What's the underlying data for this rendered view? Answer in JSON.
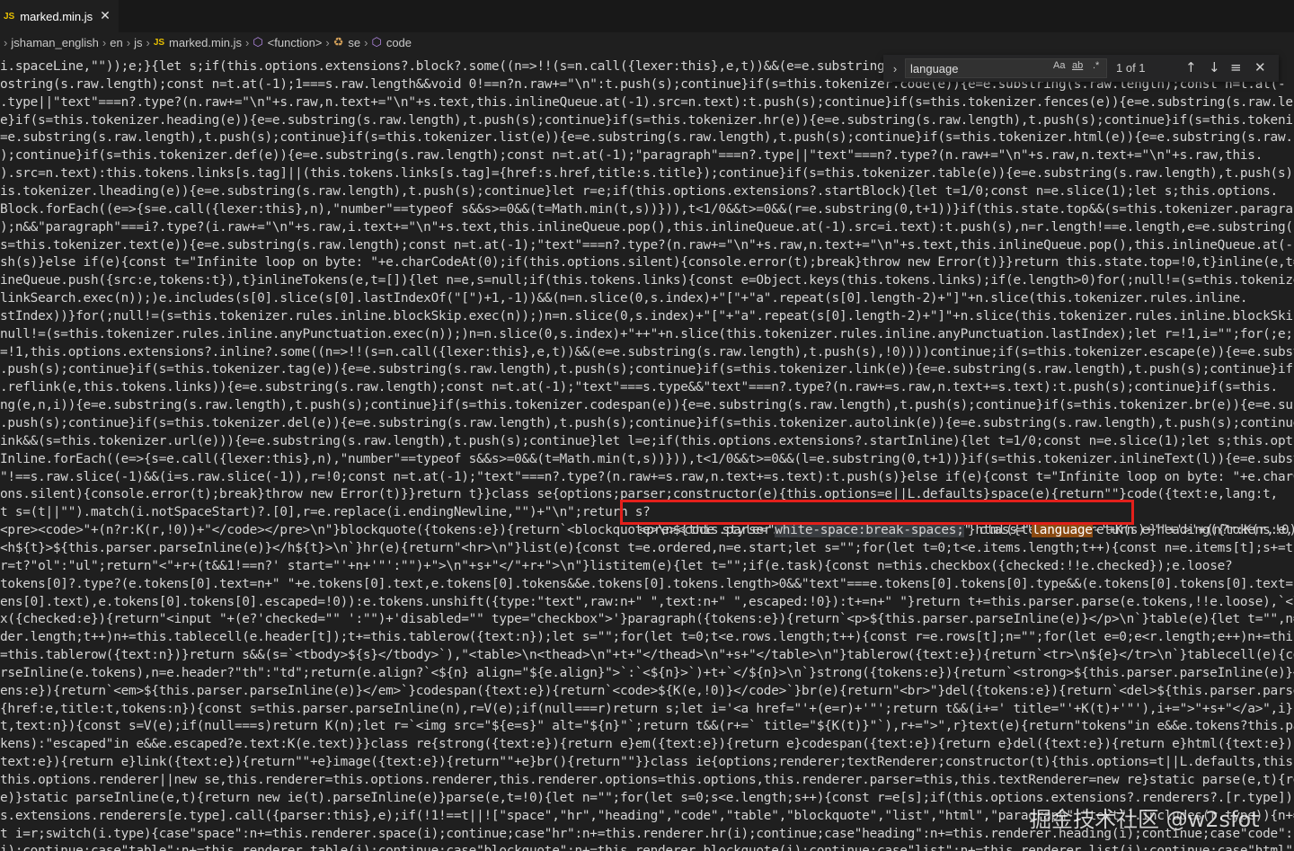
{
  "tab": {
    "icon": "JS",
    "filename": "marked.min.js",
    "close_glyph": "✕"
  },
  "breadcrumb": {
    "items": [
      "jshaman_english",
      "en",
      "js",
      "marked.min.js",
      "<function>",
      "se",
      "code"
    ],
    "file_icon": "JS"
  },
  "find_widget": {
    "query": "language",
    "match_case": "Aa",
    "whole_word": "ab",
    "regex": ".*",
    "result_count": "1 of 1"
  },
  "code_lines": [
    "i.spaceLine,\"\"));e;}{let s;if(this.options.extensions?.block?.some((n=>!!(s=n.call({lexer:this},e,t))&&(e=e.substring(s.raw.",
    "ostring(s.raw.length);const n=t.at(-1);1===s.raw.length&&void 0!==n?n.raw+=\"\\n\":t.push(s);continue}if(s=this.tokenizer.code(e)){e=e.substring(s.raw.length);const n=t.at(-",
    ".type||\"text\"===n?.type?(n.raw+=\"\\n\"+s.raw,n.text+=\"\\n\"+s.text,this.inlineQueue.at(-1).src=n.text):t.push(s);continue}if(s=this.tokenizer.fences(e)){e=e.substring(s.raw.length),",
    "e}if(s=this.tokenizer.heading(e)){e=e.substring(s.raw.length),t.push(s);continue}if(s=this.tokenizer.hr(e)){e=e.substring(s.raw.length),t.push(s);continue}if(s=this.tokenizer.",
    "=e.substring(s.raw.length),t.push(s);continue}if(s=this.tokenizer.list(e)){e=e.substring(s.raw.length),t.push(s);continue}if(s=this.tokenizer.html(e)){e=e.substring(s.raw.",
    ");continue}if(s=this.tokenizer.def(e)){e=e.substring(s.raw.length);const n=t.at(-1);\"paragraph\"===n?.type||\"text\"===n?.type?(n.raw+=\"\\n\"+s.raw,n.text+=\"\\n\"+s.raw,this.",
    ").src=n.text):this.tokens.links[s.tag]||(this.tokens.links[s.tag]={href:s.href,title:s.title});continue}if(s=this.tokenizer.table(e)){e=e.substring(s.raw.length),t.push(s);",
    "is.tokenizer.lheading(e)){e=e.substring(s.raw.length),t.push(s);continue}let r=e;if(this.options.extensions?.startBlock){let t=1/0;const n=e.slice(1);let s;this.options.",
    "Block.forEach((e=>{s=e.call({lexer:this},n),\"number\"==typeof s&&s>=0&&(t=Math.min(t,s))})),t<1/0&&t>=0&&(r=e.substring(0,t+1))}if(this.state.top&&(s=this.tokenizer.paragraph(r)))",
    ");n&&\"paragraph\"===i?.type?(i.raw+=\"\\n\"+s.raw,i.text+=\"\\n\"+s.text,this.inlineQueue.pop(),this.inlineQueue.at(-1).src=i.text):t.push(s),n=r.length!==e.length,e=e.substring(s.raw.",
    "s=this.tokenizer.text(e)){e=e.substring(s.raw.length);const n=t.at(-1);\"text\"===n?.type?(n.raw+=\"\\n\"+s.raw,n.text+=\"\\n\"+s.text,this.inlineQueue.pop(),this.inlineQueue.at(-1).",
    "sh(s)}else if(e){const t=\"Infinite loop on byte: \"+e.charCodeAt(0);if(this.options.silent){console.error(t);break}throw new Error(t)}}return this.state.top=!0,t}inline(e,t=[])",
    "ineQueue.push({src:e,tokens:t}),t}inlineTokens(e,t=[]){let n=e,s=null;if(this.tokens.links){const e=Object.keys(this.tokens.links);if(e.length>0)for(;null!=(s=this.tokenizer.",
    "linkSearch.exec(n));)e.includes(s[0].slice(s[0].lastIndexOf(\"[\")+1,-1))&&(n=n.slice(0,s.index)+\"[\"+\"a\".repeat(s[0].length-2)+\"]\"+n.slice(this.tokenizer.rules.inline.",
    "stIndex))}for(;null!=(s=this.tokenizer.rules.inline.blockSkip.exec(n));)n=n.slice(0,s.index)+\"[\"+\"a\".repeat(s[0].length-2)+\"]\"+n.slice(this.tokenizer.rules.inline.blockSkip.",
    "null!=(s=this.tokenizer.rules.inline.anyPunctuation.exec(n));)n=n.slice(0,s.index)+\"++\"+n.slice(this.tokenizer.rules.inline.anyPunctuation.lastIndex);let r=!1,i=\"\";for(;e;){let",
    "=!1,this.options.extensions?.inline?.some((n=>!!(s=n.call({lexer:this},e,t))&&(e=e.substring(s.raw.length),t.push(s),!0))))continue;if(s=this.tokenizer.escape(e)){e=e.substring",
    ".push(s);continue}if(s=this.tokenizer.tag(e)){e=e.substring(s.raw.length),t.push(s);continue}if(s=this.tokenizer.link(e)){e=e.substring(s.raw.length),t.push(s);continue}if",
    ".reflink(e,this.tokens.links)){e=e.substring(s.raw.length);const n=t.at(-1);\"text\"===s.type&&\"text\"===n?.type?(n.raw+=s.raw,n.text+=s.text):t.push(s);continue}if(s=this.",
    "ng(e,n,i)){e=e.substring(s.raw.length),t.push(s);continue}if(s=this.tokenizer.codespan(e)){e=e.substring(s.raw.length),t.push(s);continue}if(s=this.tokenizer.br(e)){e=e.substring",
    ".push(s);continue}if(s=this.tokenizer.del(e)){e=e.substring(s.raw.length),t.push(s);continue}if(s=this.tokenizer.autolink(e)){e=e.substring(s.raw.length),t.push(s);continue}if",
    "ink&&(s=this.tokenizer.url(e))){e=e.substring(s.raw.length),t.push(s);continue}let l=e;if(this.options.extensions?.startInline){let t=1/0;const n=e.slice(1);let s;this.options.",
    "Inline.forEach((e=>{s=e.call({lexer:this},n),\"number\"==typeof s&&s>=0&&(t=Math.min(t,s))})),t<1/0&&t>=0&&(l=e.substring(0,t+1))}if(s=this.tokenizer.inlineText(l)){e=e.substring",
    "\"!==s.raw.slice(-1)&&(i=s.raw.slice(-1)),r=!0;const n=t.at(-1);\"text\"===n?.type?(n.raw+=s.raw,n.text+=s.text):t.push(s)}else if(e){const t=\"Infinite loop on byte: \"+e.charCodeAt",
    "ons.silent){console.error(t);break}throw new Error(t)}}return t}}class se{options;parser;constructor(e){this.options=e||L.defaults}space(e){return\"\"}code({text:e,lang:t,",
    "t s=(t||\"\").match(i.notSpaceStart)?.[0],r=e.replace(i.endingNewline,\"\")+\"\\n\";return s?",
    "<pre><code>\"+(n?r:K(r,!0))+\"</code></pre>\\n\"}blockquote({tokens:e}){return`<blockquote>\\n${this.parser.parse(e)}</blockquote>\\n`}html({text:e}){return e}heading({tokens:e,",
    "<h${t}>${this.parser.parseInline(e)}</h${t}>\\n`}hr(e){return\"<hr>\\n\"}list(e){const t=e.ordered,n=e.start;let s=\"\";for(let t=0;t<e.items.length;t++){const n=e.items[t];s+=this.",
    "r=t?\"ol\":\"ul\";return\"<\"+r+(t&&1!==n?' start=\"'+n+'\"':\"\")+\">\\n\"+s+\"</\"+r+\">\\n\"}listitem(e){let t=\"\";if(e.task){const n=this.checkbox({checked:!!e.checked});e.loose?",
    "tokens[0]?.type?(e.tokens[0].text=n+\" \"+e.tokens[0].text,e.tokens[0].tokens&&e.tokens[0].tokens.length>0&&\"text\"===e.tokens[0].tokens[0].type&&(e.tokens[0].tokens[0].text=n+\" \"+K",
    "ens[0].text),e.tokens[0].tokens[0].escaped=!0)):e.tokens.unshift({type:\"text\",raw:n+\" \",text:n+\" \",escaped:!0}):t+=n+\" \"}return t+=this.parser.parse(e.tokens,!!e.loose),`<li>${t}",
    "x({checked:e}){return\"<input \"+(e?'checked=\"\" ':\"\")+'disabled=\"\" type=\"checkbox\">'}paragraph({tokens:e}){return`<p>${this.parser.parseInline(e)}</p>\\n`}table(e){let t=\"\",n=\"\";for",
    "der.length;t++)n+=this.tablecell(e.header[t]);t+=this.tablerow({text:n});let s=\"\";for(let t=0;t<e.rows.length;t++){const r=e.rows[t];n=\"\";for(let e=0;e<r.length;e++)n+=this.",
    "=this.tablerow({text:n})}return s&&(s=`<tbody>${s}</tbody>`),\"<table>\\n<thead>\\n\"+t+\"</thead>\\n\"+s+\"</table>\\n\"}tablerow({text:e}){return`<tr>\\n${e}</tr>\\n`}tablecell(e){const",
    "rseInline(e.tokens),n=e.header?\"th\":\"td\";return(e.align?`<${n} align=\"${e.align}\">`:`<${n}>`)+t+`</${n}>\\n`}strong({tokens:e}){return`<strong>${this.parser.parseInline(e)}</",
    "ens:e}){return`<em>${this.parser.parseInline(e)}</em>`}codespan({text:e}){return`<code>${K(e,!0)}</code>`}br(e){return\"<br>\"}del({tokens:e}){return`<del>${this.parser.parseInline",
    "{href:e,title:t,tokens:n}){const s=this.parser.parseInline(n),r=V(e);if(null===r)return s;let i='<a href=\"'+(e=r)+'\"';return t&&(i+=' title=\"'+K(t)+'\"'),i+=\">\"+s+\"</a>\",i}image",
    "t,text:n}){const s=V(e);if(null===s)return K(n);let r=`<img src=\"${e=s}\" alt=\"${n}\"`;return t&&(r+=` title=\"${K(t)}\"`),r+=\">\",r}text(e){return\"tokens\"in e&&e.tokens?this.parser.",
    "kens):\"escaped\"in e&&e.escaped?e.text:K(e.text)}}class re{strong({text:e}){return e}em({text:e}){return e}codespan({text:e}){return e}del({text:e}){return e}html({text:e})",
    "text:e}){return e}link({text:e}){return\"\"+e}image({text:e}){return\"\"+e}br(){return\"\"}}class ie{options;renderer;textRenderer;constructor(t){this.options=t||L.defaults,this.",
    "this.options.renderer||new se,this.renderer=this.options.renderer,this.renderer.options=this.options,this.renderer.parser=this,this.textRenderer=new re}static parse(e,t){return",
    "e)}static parseInline(e,t){return new ie(t).parseInline(e)}parse(e,t=!0){let n=\"\";for(let s=0;s<e.length;s++){const r=e[s];if(this.options.extensions?.renderers?.[r.type]){const",
    "s.extensions.renderers[e.type].call({parser:this},e);if(!1!==t||![\"space\",\"hr\",\"heading\",\"code\",\"table\",\"blockquote\",\"list\",\"html\",\"paragraph\",\"text\"].includes(r.type)){n+=",
    "t i=r;switch(i.type){case\"space\":n+=this.renderer.space(i);continue;case\"hr\":n+=this.renderer.hr(i);continue;case\"heading\":n+=this.renderer.heading(i);continue;case\"code\":n",
    "i);continue;case\"table\":n+=this.renderer.table(i);continue;case\"blockquote\":n+=this.renderer.blockquote(i);continue;case\"list\":n+=this.renderer.list(i);continue;case\"html\":"
  ],
  "highlight_line": {
    "before": "<pre><code style=\"",
    "selected": "white-space:break-spaces;",
    "middle": "\" class=\"",
    "match": "language",
    "after": "-'+K(s)+'\"",
    "tail": "+'>'+(n?r:K(r,!0))+\"</"
  },
  "watermark": "掘金技术社区 @w2sfot"
}
